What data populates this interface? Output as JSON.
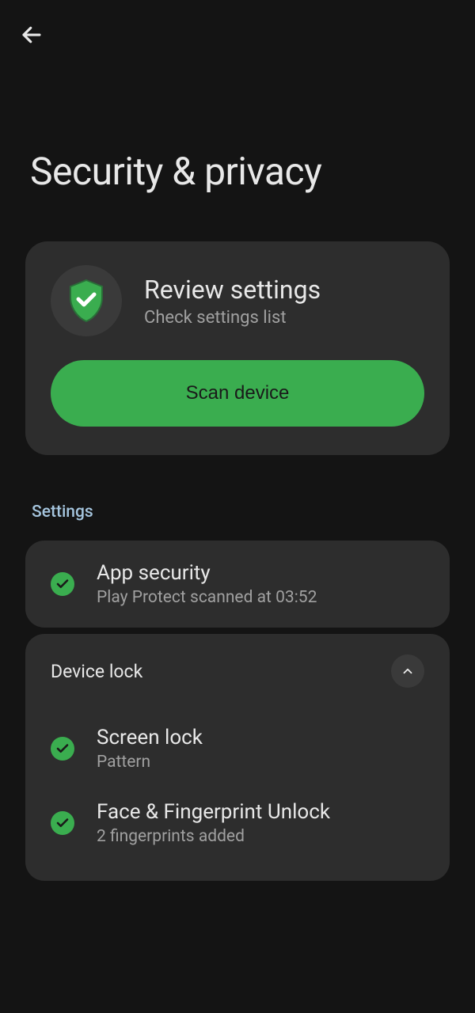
{
  "page": {
    "title": "Security & privacy"
  },
  "review": {
    "title": "Review settings",
    "subtitle": "Check settings list",
    "button_label": "Scan device"
  },
  "section": {
    "label": "Settings"
  },
  "app_security": {
    "title": "App security",
    "subtitle": "Play Protect scanned at 03:52"
  },
  "device_lock": {
    "header": "Device lock",
    "items": [
      {
        "title": "Screen lock",
        "subtitle": "Pattern"
      },
      {
        "title": "Face & Fingerprint Unlock",
        "subtitle": "2 fingerprints added"
      }
    ]
  }
}
